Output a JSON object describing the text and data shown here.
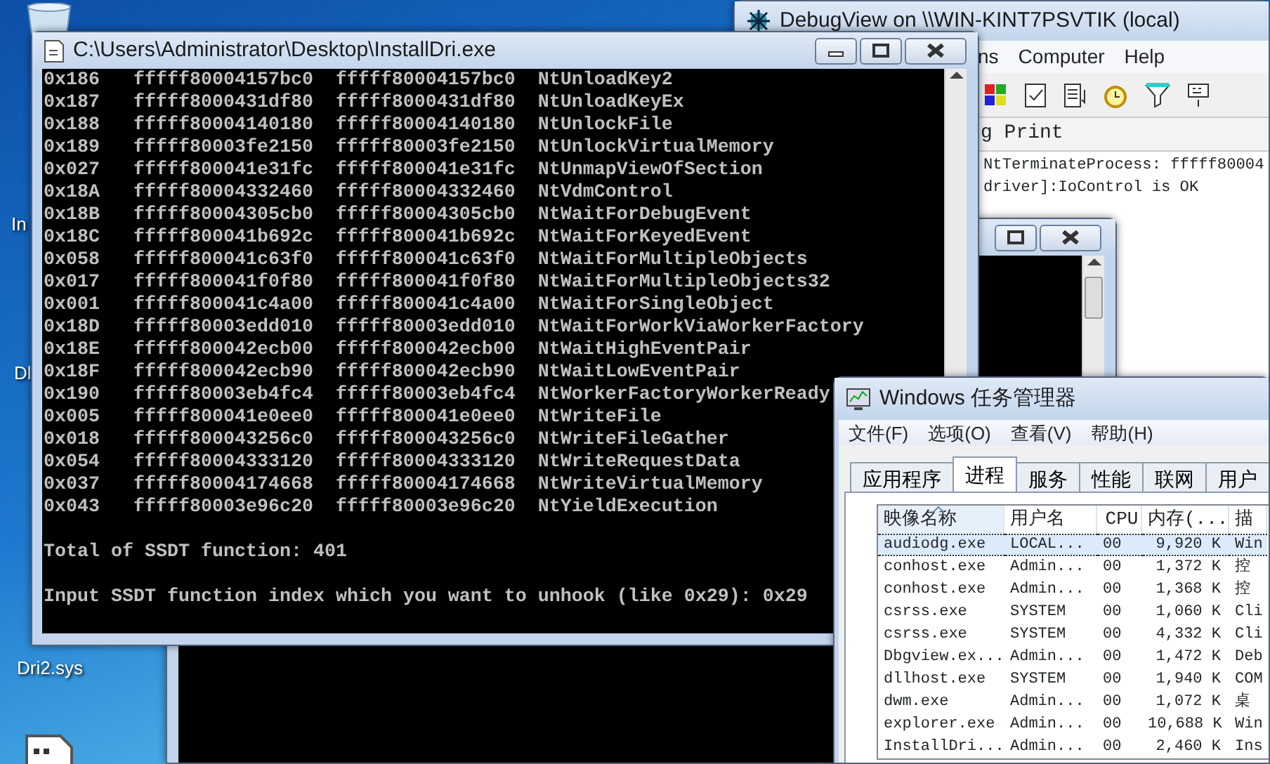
{
  "desktop": {
    "icons": [
      {
        "label": "In"
      },
      {
        "label": "Dl"
      },
      {
        "label": "Dri2.sys"
      }
    ]
  },
  "debugview": {
    "title": "DebugView on \\\\WIN-KINT7PSVTIK (local)",
    "menu": [
      "ns",
      "Computer",
      "Help"
    ],
    "column_header": "g Print",
    "lines": [
      "NtTerminateProcess: fffff80004",
      "driver]:IoControl is OK"
    ]
  },
  "console": {
    "title": "C:\\Users\\Administrator\\Desktop\\InstallDri.exe",
    "rows": [
      {
        "index": "0x186",
        "address_1": "fffff80004157bc0",
        "address_2": "fffff80004157bc0",
        "name": "NtUnloadKey2"
      },
      {
        "index": "0x187",
        "address_1": "fffff8000431df80",
        "address_2": "fffff8000431df80",
        "name": "NtUnloadKeyEx"
      },
      {
        "index": "0x188",
        "address_1": "fffff80004140180",
        "address_2": "fffff80004140180",
        "name": "NtUnlockFile"
      },
      {
        "index": "0x189",
        "address_1": "fffff80003fe2150",
        "address_2": "fffff80003fe2150",
        "name": "NtUnlockVirtualMemory"
      },
      {
        "index": "0x027",
        "address_1": "fffff800041e31fc",
        "address_2": "fffff800041e31fc",
        "name": "NtUnmapViewOfSection"
      },
      {
        "index": "0x18A",
        "address_1": "fffff80004332460",
        "address_2": "fffff80004332460",
        "name": "NtVdmControl"
      },
      {
        "index": "0x18B",
        "address_1": "fffff80004305cb0",
        "address_2": "fffff80004305cb0",
        "name": "NtWaitForDebugEvent"
      },
      {
        "index": "0x18C",
        "address_1": "fffff800041b692c",
        "address_2": "fffff800041b692c",
        "name": "NtWaitForKeyedEvent"
      },
      {
        "index": "0x058",
        "address_1": "fffff800041c63f0",
        "address_2": "fffff800041c63f0",
        "name": "NtWaitForMultipleObjects"
      },
      {
        "index": "0x017",
        "address_1": "fffff800041f0f80",
        "address_2": "fffff800041f0f80",
        "name": "NtWaitForMultipleObjects32"
      },
      {
        "index": "0x001",
        "address_1": "fffff800041c4a00",
        "address_2": "fffff800041c4a00",
        "name": "NtWaitForSingleObject"
      },
      {
        "index": "0x18D",
        "address_1": "fffff80003edd010",
        "address_2": "fffff80003edd010",
        "name": "NtWaitForWorkViaWorkerFactory"
      },
      {
        "index": "0x18E",
        "address_1": "fffff800042ecb00",
        "address_2": "fffff800042ecb00",
        "name": "NtWaitHighEventPair"
      },
      {
        "index": "0x18F",
        "address_1": "fffff800042ecb90",
        "address_2": "fffff800042ecb90",
        "name": "NtWaitLowEventPair"
      },
      {
        "index": "0x190",
        "address_1": "fffff80003eb4fc4",
        "address_2": "fffff80003eb4fc4",
        "name": "NtWorkerFactoryWorkerReady"
      },
      {
        "index": "0x005",
        "address_1": "fffff800041e0ee0",
        "address_2": "fffff800041e0ee0",
        "name": "NtWriteFile"
      },
      {
        "index": "0x018",
        "address_1": "fffff800043256c0",
        "address_2": "fffff800043256c0",
        "name": "NtWriteFileGather"
      },
      {
        "index": "0x054",
        "address_1": "fffff80004333120",
        "address_2": "fffff80004333120",
        "name": "NtWriteRequestData"
      },
      {
        "index": "0x037",
        "address_1": "fffff80004174668",
        "address_2": "fffff80004174668",
        "name": "NtWriteVirtualMemory"
      },
      {
        "index": "0x043",
        "address_1": "fffff80003e96c20",
        "address_2": "fffff80003e96c20",
        "name": "NtYieldExecution"
      }
    ],
    "total": "Total of SSDT function: 401",
    "prompt": "Input SSDT function index which you want to unhook (like 0x29): 0x29"
  },
  "task_manager": {
    "title": "Windows 任务管理器",
    "menu": [
      "文件(F)",
      "选项(O)",
      "查看(V)",
      "帮助(H)"
    ],
    "tabs": [
      {
        "label": "应用程序",
        "selected": false
      },
      {
        "label": "进程",
        "selected": true
      },
      {
        "label": "服务",
        "selected": false
      },
      {
        "label": "性能",
        "selected": false
      },
      {
        "label": "联网",
        "selected": false
      },
      {
        "label": "用户",
        "selected": false
      }
    ],
    "columns": [
      "映像名称",
      "用户名",
      "CPU",
      "内存(...",
      "描"
    ],
    "rows": [
      {
        "cells": [
          "audiodg.exe",
          "LOCAL...",
          "00",
          "9,920 K",
          "Win"
        ],
        "selected": true
      },
      {
        "cells": [
          "conhost.exe",
          "Admin...",
          "00",
          "1,372 K",
          "控"
        ],
        "selected": false
      },
      {
        "cells": [
          "conhost.exe",
          "Admin...",
          "00",
          "1,368 K",
          "控"
        ],
        "selected": false
      },
      {
        "cells": [
          "csrss.exe",
          "SYSTEM",
          "00",
          "1,060 K",
          "Cli"
        ],
        "selected": false
      },
      {
        "cells": [
          "csrss.exe",
          "SYSTEM",
          "00",
          "4,332 K",
          "Cli"
        ],
        "selected": false
      },
      {
        "cells": [
          "Dbgview.ex...",
          "Admin...",
          "00",
          "1,472 K",
          "Deb"
        ],
        "selected": false
      },
      {
        "cells": [
          "dllhost.exe",
          "SYSTEM",
          "00",
          "1,940 K",
          "COM"
        ],
        "selected": false
      },
      {
        "cells": [
          "dwm.exe",
          "Admin...",
          "00",
          "1,072 K",
          "桌"
        ],
        "selected": false
      },
      {
        "cells": [
          "explorer.exe",
          "Admin...",
          "00",
          "10,688 K",
          "Win"
        ],
        "selected": false
      },
      {
        "cells": [
          "InstallDri...",
          "Admin...",
          "00",
          "2,460 K",
          "Ins"
        ],
        "selected": false
      }
    ]
  }
}
